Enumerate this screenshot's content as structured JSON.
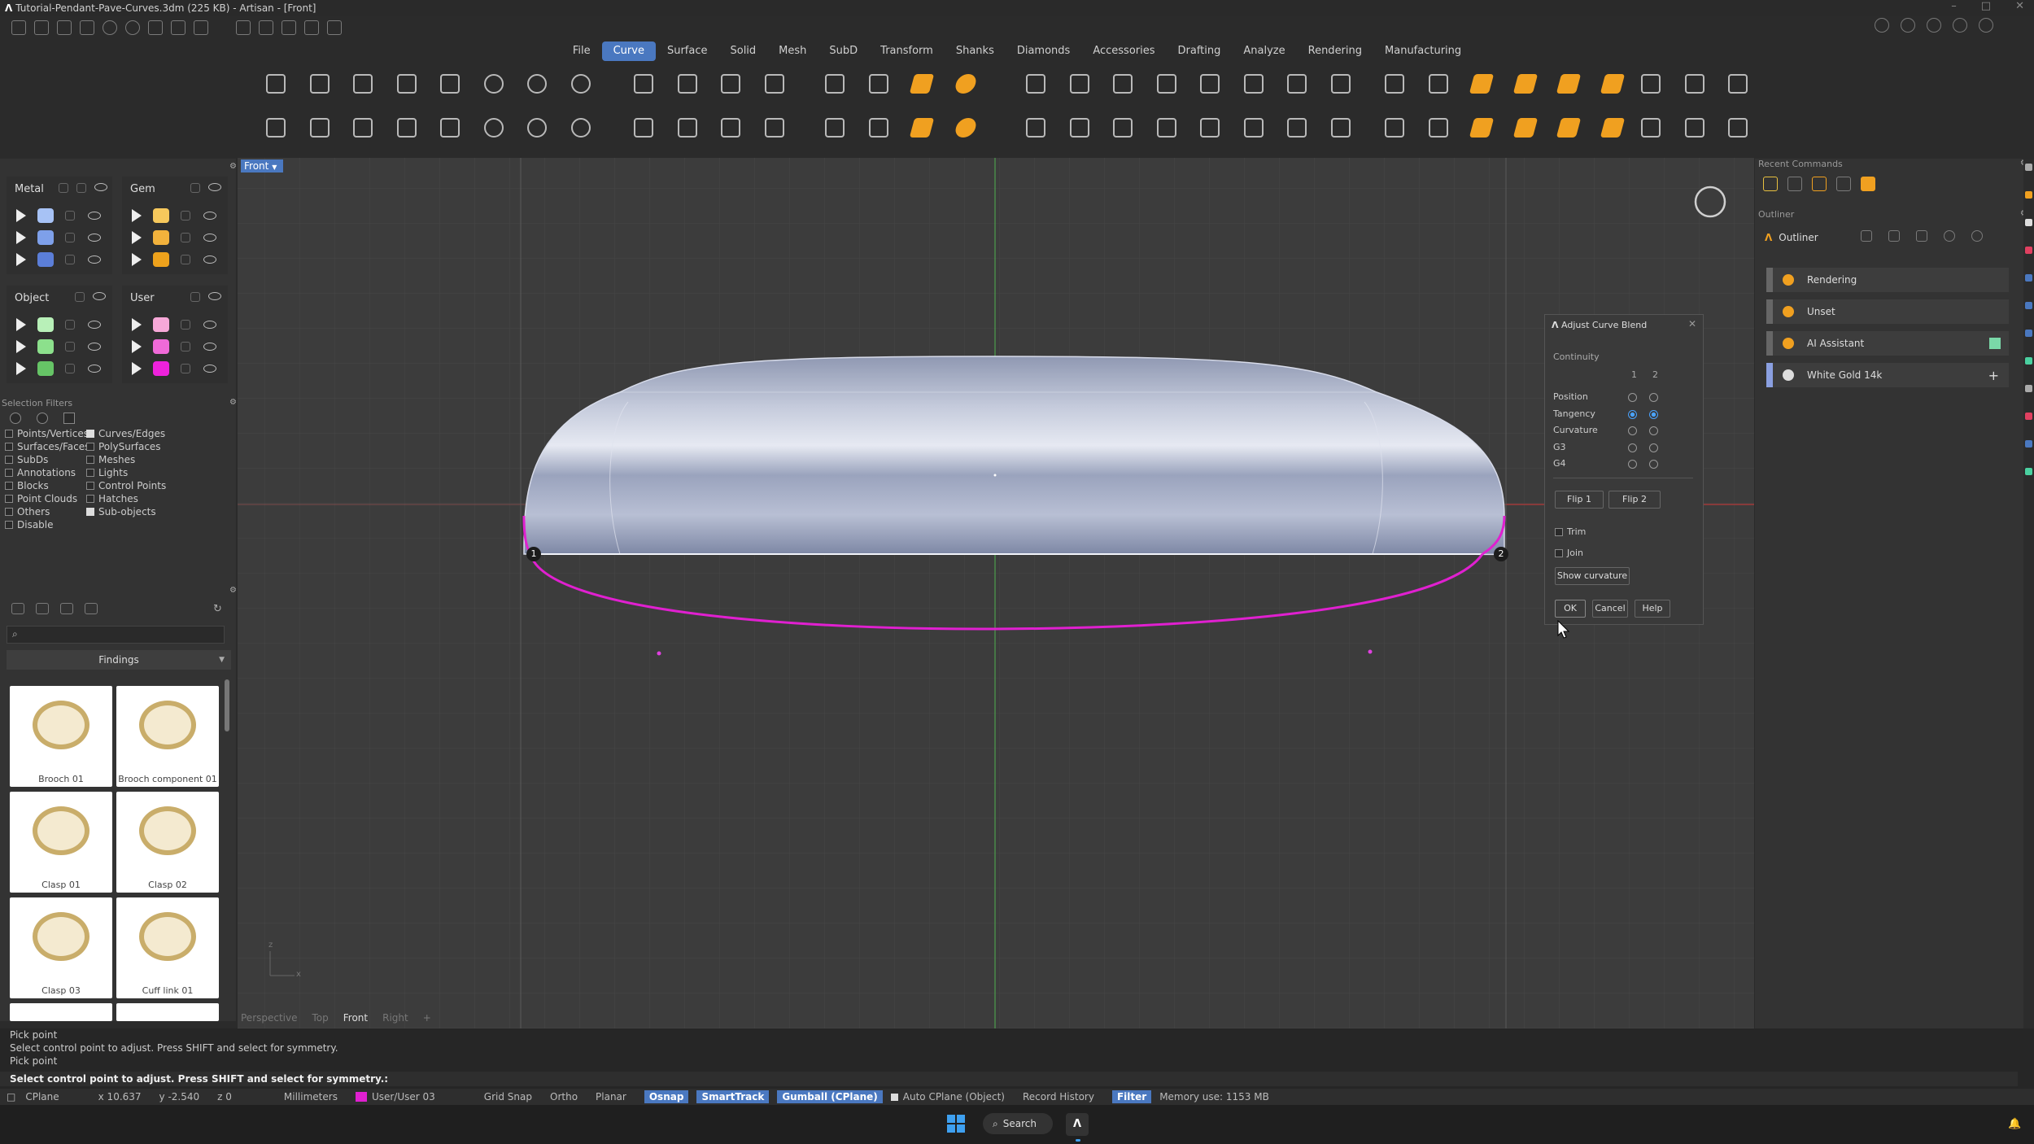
{
  "window": {
    "title": "Tutorial-Pendant-Pave-Curves.3dm (225 KB) - Artisan - [Front]"
  },
  "menu": [
    "File",
    "Curve",
    "Surface",
    "Solid",
    "Mesh",
    "SubD",
    "Transform",
    "Shanks",
    "Diamonds",
    "Accessories",
    "Drafting",
    "Analyze",
    "Rendering",
    "Manufacturing"
  ],
  "menu_active": "Curve",
  "layers": {
    "metal": {
      "title": "Metal",
      "colors": [
        "#a7c2f5",
        "#7ea0ea",
        "#5b7ed8"
      ]
    },
    "gem": {
      "title": "Gem",
      "colors": [
        "#f6c85c",
        "#f2b23c",
        "#eea21c"
      ]
    },
    "object": {
      "title": "Object",
      "colors": [
        "#b8f0b8",
        "#8ce08c",
        "#66c466"
      ]
    },
    "user": {
      "title": "User",
      "colors": [
        "#f7a8d8",
        "#f06ad8",
        "#ee22dc"
      ]
    }
  },
  "selection_filters": {
    "title": "Selection Filters",
    "left": [
      {
        "label": "Points/Vertices",
        "on": false
      },
      {
        "label": "Surfaces/Faces",
        "on": false
      },
      {
        "label": "SubDs",
        "on": false
      },
      {
        "label": "Annotations",
        "on": false
      },
      {
        "label": "Blocks",
        "on": false
      },
      {
        "label": "Point Clouds",
        "on": false
      },
      {
        "label": "Others",
        "on": false
      },
      {
        "label": "Disable",
        "on": false
      }
    ],
    "right": [
      {
        "label": "Curves/Edges",
        "on": true
      },
      {
        "label": "PolySurfaces",
        "on": false
      },
      {
        "label": "Meshes",
        "on": false
      },
      {
        "label": "Lights",
        "on": false
      },
      {
        "label": "Control Points",
        "on": false
      },
      {
        "label": "Hatches",
        "on": false
      },
      {
        "label": "Sub-objects",
        "on": true
      }
    ]
  },
  "findings": {
    "header": "Findings",
    "items": [
      "Brooch 01",
      "Brooch component 01",
      "Clasp 01",
      "Clasp 02",
      "Clasp 03",
      "Cuff link 01"
    ]
  },
  "viewport": {
    "active_tab": "Front",
    "tabs": [
      "Perspective",
      "Top",
      "Front",
      "Right",
      "+"
    ],
    "point_labels": [
      "1",
      "2"
    ],
    "axis_y": "z",
    "axis_x": "x"
  },
  "dialog": {
    "title": "Adjust Curve Blend",
    "continuity_label": "Continuity",
    "col1": "1",
    "col2": "2",
    "rows": [
      {
        "label": "Position",
        "s1": false,
        "s2": false
      },
      {
        "label": "Tangency",
        "s1": true,
        "s2": true
      },
      {
        "label": "Curvature",
        "s1": false,
        "s2": false
      },
      {
        "label": "G3",
        "s1": false,
        "s2": false
      },
      {
        "label": "G4",
        "s1": false,
        "s2": false
      }
    ],
    "flip1": "Flip 1",
    "flip2": "Flip 2",
    "trim": "Trim",
    "join": "Join",
    "show_curvature": "Show curvature",
    "ok": "OK",
    "cancel": "Cancel",
    "help": "Help"
  },
  "right_panel": {
    "recent_commands": "Recent Commands",
    "outliner_header": "Outliner",
    "outliner_title": "Outliner",
    "rows": [
      {
        "label": "Rendering",
        "color": "#f0a020",
        "extra": ""
      },
      {
        "label": "Unset",
        "color": "#f0a020",
        "extra": ""
      },
      {
        "label": "AI Assistant",
        "color": "#f0a020",
        "extra": "swatch"
      },
      {
        "label": "White Gold 14k",
        "color": "#dddddd",
        "extra": "+"
      }
    ]
  },
  "command": {
    "history": [
      "Pick point",
      "Select control point to adjust. Press SHIFT and select for symmetry.",
      "Pick point"
    ],
    "prompt": "Select control point to adjust. Press SHIFT and select for symmetry.:"
  },
  "status": {
    "cplane": "CPlane",
    "x": "x 10.637",
    "y": "y -2.540",
    "z": "z 0",
    "units": "Millimeters",
    "layer": "User/User 03",
    "grid_snap": "Grid Snap",
    "ortho": "Ortho",
    "planar": "Planar",
    "osnap": "Osnap",
    "smarttrack": "SmartTrack",
    "gumball": "Gumball (CPlane)",
    "auto_cplane": "Auto CPlane (Object)",
    "record_history": "Record History",
    "filter": "Filter",
    "memory": "Memory use: 1153 MB"
  },
  "taskbar": {
    "search": "Search"
  },
  "colors": {
    "accent": "#4a78c0",
    "curve": "#e020d0",
    "gem_orange": "#f0a020"
  }
}
